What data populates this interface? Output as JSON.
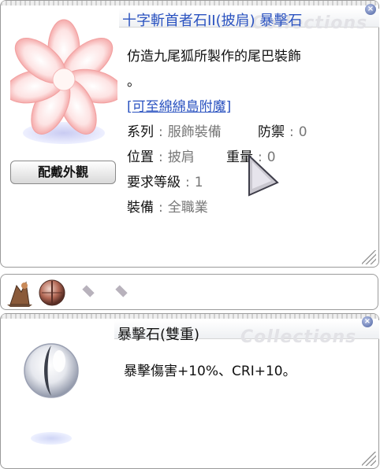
{
  "item_window": {
    "title": "十字斬首者石II(披肩) 暴擊石",
    "watermark": "Collections",
    "description_line1": "仿造九尾狐所製作的尾巴裝飾",
    "description_line2": "。",
    "enchant_link": "[可至綿綿島附魔]",
    "stats": {
      "type_label": "系列",
      "type_value": "服飾裝備",
      "defense_label": "防禦",
      "defense_value": "0",
      "position_label": "位置",
      "position_value": "披肩",
      "weight_label": "重量",
      "weight_value": "0",
      "level_label": "要求等級",
      "level_value": "1",
      "equip_label": "裝備",
      "equip_value": "全職業"
    },
    "appearance_button": "配戴外觀",
    "close_icon": "close-icon"
  },
  "slot_bar": {
    "slots": [
      {
        "icon": "card-slot-icon",
        "filled": true
      },
      {
        "icon": "orb-slot-icon",
        "filled": true
      },
      {
        "icon": "empty-slot-icon",
        "filled": false
      },
      {
        "icon": "empty-slot-icon",
        "filled": false
      }
    ]
  },
  "card_window": {
    "title": "暴擊石(雙重)",
    "watermark": "Collections",
    "effect": "暴擊傷害+10%、CRI+10。",
    "close_icon": "close-icon"
  },
  "colors": {
    "title_blue": "#2a52c0",
    "link_blue": "#2a52c0",
    "value_gray": "#777777",
    "close_blue": "#4a5f9e"
  }
}
